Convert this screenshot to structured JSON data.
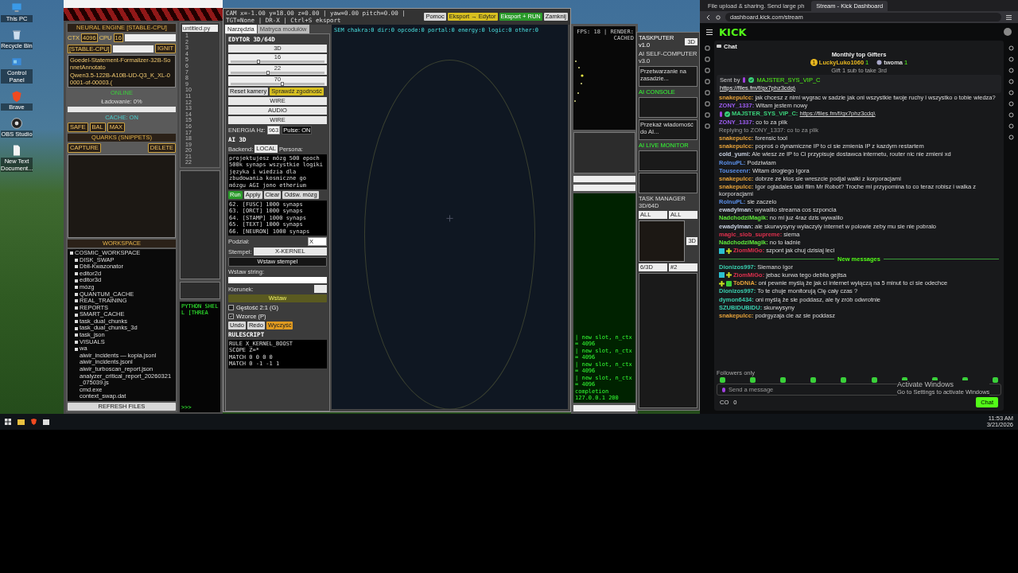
{
  "desktop": {
    "icons": [
      {
        "kind": "pc",
        "label": "This PC"
      },
      {
        "kind": "bin",
        "label": "Recycle Bin"
      },
      {
        "kind": "panel",
        "label": "Control Panel"
      },
      {
        "kind": "brave",
        "label": "Brave"
      },
      {
        "kind": "obs",
        "label": "OBS Studio"
      },
      {
        "kind": "doc",
        "label": "New Text Document..."
      }
    ]
  },
  "engine_window": {
    "title": "NEURAL ENGINE [STABLE-CPU]",
    "ctx_label": "CTX",
    "ctx": "4096",
    "cpu_label": "CPU",
    "cpu": "16",
    "mode": "[STABLE-CPU]",
    "ignite": "IGNIT",
    "models": [
      "Goedel-Statement-Formalizer-32B-SonnetAnnotato",
      "Qwen3.5-122B-A10B-UD-Q3_K_XL-00001-of-00003.("
    ],
    "status": "ONLINE",
    "loading": "Ładowanie: 0%",
    "progress": {
      "level": 0
    },
    "cache": "CACHE: ON",
    "profiles": [
      {
        "label": "SAFE"
      },
      {
        "label": "BAL"
      },
      {
        "label": "MAX"
      }
    ],
    "quarks_title": "QUARKS (SNIPPETS)",
    "capture": "CAPTURE",
    "delete": "DELETE",
    "workspace_title": "WORKSPACE",
    "tree": [
      {
        "kind": "folder",
        "label": "COSMIC_WORKSPACE",
        "children": [
          {
            "kind": "folder",
            "label": "DISK_SWAP"
          },
          {
            "kind": "folder",
            "label": "Dbll-Kwazonator"
          },
          {
            "kind": "folder",
            "label": "editor2d"
          },
          {
            "kind": "folder",
            "label": "editor3d"
          },
          {
            "kind": "folder",
            "label": "mózg"
          },
          {
            "kind": "folder",
            "label": "QUANTUM_CACHE"
          },
          {
            "kind": "folder",
            "label": "REAL_TRAINING"
          },
          {
            "kind": "folder",
            "label": "REPORTS"
          },
          {
            "kind": "folder",
            "label": "SMART_CACHE"
          },
          {
            "kind": "folder",
            "label": "task_dual_chunks"
          },
          {
            "kind": "folder",
            "label": "task_dual_chunks_3d"
          },
          {
            "kind": "folder",
            "label": "task_json"
          },
          {
            "kind": "folder",
            "label": "VISUALS"
          },
          {
            "kind": "folder",
            "label": "wa",
            "children": [
              {
                "kind": "file",
                "label": "aiwir_incidents — kopia.jsonl"
              },
              {
                "kind": "file",
                "label": "aiwir_incidents.jsonl"
              },
              {
                "kind": "file",
                "label": "aiwir_turboscan_report.json"
              },
              {
                "kind": "file",
                "label": "analyzer_critical_report_20260321_075039.js"
              },
              {
                "kind": "file",
                "label": "cmd.exe"
              },
              {
                "kind": "file",
                "label": "context_swap.dat"
              }
            ]
          }
        ]
      }
    ],
    "refresh": "REFRESH FILES"
  },
  "code_window": {
    "tab": "untitled.py",
    "line_numbers": [
      "1",
      "2",
      "3",
      "4",
      "5",
      "6",
      "7",
      "8",
      "9",
      "10",
      "11",
      "12",
      "13",
      "14",
      "15",
      "16",
      "17",
      "18",
      "19",
      "20",
      "21",
      "22"
    ],
    "shell_title": "PYTHON SHELL [THREA",
    "prompt": ">>>"
  },
  "editor_window": {
    "status": "CAM x=-1.00 y=18.00 z=0.00 | yaw=0.00 pitch=0.00 | TGT=None | DR-X | Ctrl+S eksport",
    "buttons": [
      {
        "kind": "plain",
        "label": "Pomoc"
      },
      {
        "kind": "export",
        "label": "Eksport → Edytor"
      },
      {
        "kind": "run",
        "label": "Eksport + RUN"
      },
      {
        "kind": "plain",
        "label": "Zamknij"
      }
    ],
    "tabs": [
      {
        "label": "Narzędzia",
        "selected": true
      },
      {
        "label": "Matryca modułów",
        "selected": false
      }
    ],
    "panel_title": "EDYTOR 3D/64D",
    "mode_value": "3D",
    "sliders": [
      {
        "value": "16",
        "level": 0.3
      },
      {
        "value": "22",
        "level": 0.4
      },
      {
        "value": "70",
        "level": 0.55
      }
    ],
    "view_buttons": [
      {
        "kind": "plain",
        "label": "Reset kamery"
      },
      {
        "kind": "check",
        "label": "Sprawdź zgodność"
      }
    ],
    "selects": [
      "WIRE",
      "AUDIO",
      "WIRE"
    ],
    "energy_label": "ENERGIA Hz:",
    "energy": "963",
    "pulse": "Pulse: ON",
    "ai_title": "AI 3D",
    "backend_label": "Backend:",
    "backend": "LOCAL",
    "persona_label": "Persona:",
    "prompt": "projektujesz mózg 500 epoch 500k synaps wszystkie logiki języka i wiedzia dla zbudowania kosmiczne go mózgu AGI jono etherium",
    "ai_buttons": [
      {
        "kind": "run",
        "label": "Run"
      },
      {
        "kind": "plain",
        "label": "Apply"
      },
      {
        "kind": "plain",
        "label": "Clear"
      },
      {
        "kind": "plain",
        "label": "Odśw. mózg"
      }
    ],
    "log": [
      "62. [FUSC] 1000 synaps",
      "63. [ORCT] 1000 synaps",
      "64. [STAMP] 1000 synaps",
      "65. [TEXT] 1000 synaps",
      "66. [NEURON] 1000 synaps"
    ],
    "split_label": "Podział:",
    "split": "X",
    "stamp_label": "Stempel:",
    "stamp": "X-KERNEL",
    "stamp_button": "Wstaw stempel",
    "string_label": "Wstaw string:",
    "direction_label": "Kierunek:",
    "insert": "Wstaw",
    "checks": [
      {
        "label": "Gęstość 2:1 (G)",
        "checked": false
      },
      {
        "label": "Wzorce (P)",
        "checked": true
      }
    ],
    "history": [
      {
        "kind": "plain",
        "label": "Undo"
      },
      {
        "kind": "plain",
        "label": "Redo"
      },
      {
        "kind": "clear",
        "label": "Wyczyść"
      }
    ],
    "rulescript_title": "RULESCRIPT",
    "rules": [
      "RULE X_KERNEL_BOOST",
      "SCOPE Z=*",
      "MATCH 0 0 0 0",
      "MATCH 0 -1 -1 1"
    ],
    "canvas_stats": "SEM chakra:0 dir:0 opcode:0 portal:0 energy:0 logic:0 other:0"
  },
  "render_window": {
    "status": "FPS: 18 | RENDER: CACHED",
    "log": [
      "| new slot, n_ctx = 4096",
      "| new slot, n_ctx = 4096",
      "| new slot, n_ctx = 4096",
      "| new slot, n_ctx = 4096",
      "completion 127.0.0.1 200"
    ]
  },
  "taskputer_window": {
    "title": "TASKPUTER v1.0",
    "tab": "3D",
    "self_title": "AI SELF-COMPUTER v3.0",
    "queue_line": "Przetwarzanie na zasadzie...",
    "console_title": "AI CONSOLE",
    "message_hint": "Przekaż wiadomość do AI...",
    "monitor_title": "AI LIVE MONITOR",
    "manager_title": "TASK MANAGER 3D/64D",
    "filters": [
      "ALL",
      "ALL"
    ],
    "dim": "3D",
    "dims": [
      "6/3D",
      "#2"
    ]
  },
  "browser": {
    "tabs": [
      {
        "title": "File upload & sharing. Send large ph",
        "selected": false
      },
      {
        "title": "Stream - Kick Dashboard",
        "selected": true
      }
    ],
    "url": "dashboard.kick.com/stream",
    "logo": "KICK",
    "chat_title": "Chat",
    "gifters_title": "Monthly top Gifters",
    "gifters": [
      {
        "kind": "first",
        "rank": "1",
        "name": "LuckyLuko1060",
        "count": "1"
      },
      {
        "kind": "second",
        "name": "twoma",
        "count": "1"
      }
    ],
    "gift_hint": "Gift 1 sub to take 3rd",
    "pinned": {
      "label": "Sent by",
      "user": "MAJSTER_SYS_VIP_C",
      "link": "https://files.fm/f/gx7phz3cdq\\"
    },
    "messages": [
      {
        "user": "snakepulcc:",
        "color": "#e8a33a",
        "text": "jak chcesz z nimi wygrac w sadzie jak oni wszystkie twoje ruchy i wszystko o tobie wiedza?"
      },
      {
        "user": "ZONY_1337:",
        "color": "#9b5cf0",
        "text": "Witam jestem nowy"
      },
      {
        "user": "MAJSTER_SYS_VIP_C:",
        "color": "#3ad07a",
        "text": "https://files.fm/f/gx7phz3cdq\\",
        "link": true,
        "badges": [
          {
            "kind": "mic"
          },
          {
            "kind": "verified"
          }
        ]
      },
      {
        "user": "ZONY_1337:",
        "color": "#9b5cf0",
        "text": "co to za plik"
      },
      {
        "user": "snakepulcc:",
        "color": "#e8a33a",
        "text": "forensic tool",
        "reply": "Replying to ZONY_1337: co to za plik"
      },
      {
        "user": "snakepulcc:",
        "color": "#e8a33a",
        "text": "poproś o dynamiczne IP to ci sie zmienia IP z kazdym restartem"
      },
      {
        "user": "cold_yumi:",
        "color": "#c8d0e0",
        "text": "Ale wiesz ze IP to Ci przypisuje dostawca internetu, router nic nie zmieni xd"
      },
      {
        "user": "RolnuPL:",
        "color": "#5b8fe8",
        "text": "Podziwiam"
      },
      {
        "user": "Touseeenr:",
        "color": "#5b8fe8",
        "text": "Witam drogiego Igora"
      },
      {
        "user": "snakepulcc:",
        "color": "#e8a33a",
        "text": "dobrze ze ktos sie wreszcie podjal walki z korporacjami"
      },
      {
        "user": "snakepulcc:",
        "color": "#e8a33a",
        "text": "Igor ogladales taki film Mr Robot? Troche mi przypomina to co teraz robisz i walka z korporacjami"
      },
      {
        "user": "RolnuPL:",
        "color": "#5b8fe8",
        "text": "sie zaczelo"
      },
      {
        "user": "ewadylman:",
        "color": "#c8d0e0",
        "text": "wywalilo streama cos szponcia"
      },
      {
        "user": "NadchodziMagik:",
        "color": "#5ee83a",
        "text": "no mi juz 4raz dzis wywalilo"
      },
      {
        "user": "ewadylman:",
        "color": "#c8d0e0",
        "text": "ale skurwysyny wylaczyly internet w polowie zeby mu sie nie pobralo"
      },
      {
        "user": "magic_slob_supreme:",
        "color": "#e0304e",
        "text": "siema"
      },
      {
        "user": "NadchodziMagik:",
        "color": "#5ee83a",
        "text": "no to ładnie"
      },
      {
        "user": "ZiomMiGo:",
        "color": "#e0304e",
        "text": "szpont jak chuj dzisiaj leci",
        "badges": [
          {
            "kind": "subscriber"
          },
          {
            "kind": "plus"
          }
        ]
      }
    ],
    "divider": "New messages",
    "new_messages": [
      {
        "user": "Dionizos997:",
        "color": "#3ad0b0",
        "text": "Siemano Igor"
      },
      {
        "user": "ZiomMiGo:",
        "color": "#e0304e",
        "text": "jebac kurwa tego debila gejtsa",
        "badges": [
          {
            "kind": "subscriber"
          },
          {
            "kind": "plus"
          }
        ]
      },
      {
        "user": "ToDNiA:",
        "color": "#e8a33a",
        "text": "oni pewnie myślą że jak ci internet wyłączą na 5 minut to ci sie odechce",
        "badges": [
          {
            "kind": "plus"
          },
          {
            "kind": "gift"
          }
        ]
      },
      {
        "user": "Dionizos997:",
        "color": "#3ad0b0",
        "text": "To te chuje monitorują Cię cały czas ?"
      },
      {
        "user": "dymon6434:",
        "color": "#3ad0b0",
        "text": "oni myślą że sie poddasz, ale ty zrób odwrotnie"
      },
      {
        "user": "SZUBIDUBIDU:",
        "color": "#3ad0b0",
        "text": "skurwysyny"
      },
      {
        "user": "snakepulcc:",
        "color": "#e8a33a",
        "text": "podrgyzaja cie az sie poddasz"
      }
    ],
    "followers": "Followers only",
    "input_placeholder": "Send a message",
    "viewers": "CO",
    "count": "0",
    "send": "Chat"
  },
  "activation": {
    "title": "Activate Windows",
    "hint": "Go to Settings to activate Windows"
  },
  "taskbar": {
    "time": "11:53 AM",
    "date": "3/21/2026"
  }
}
